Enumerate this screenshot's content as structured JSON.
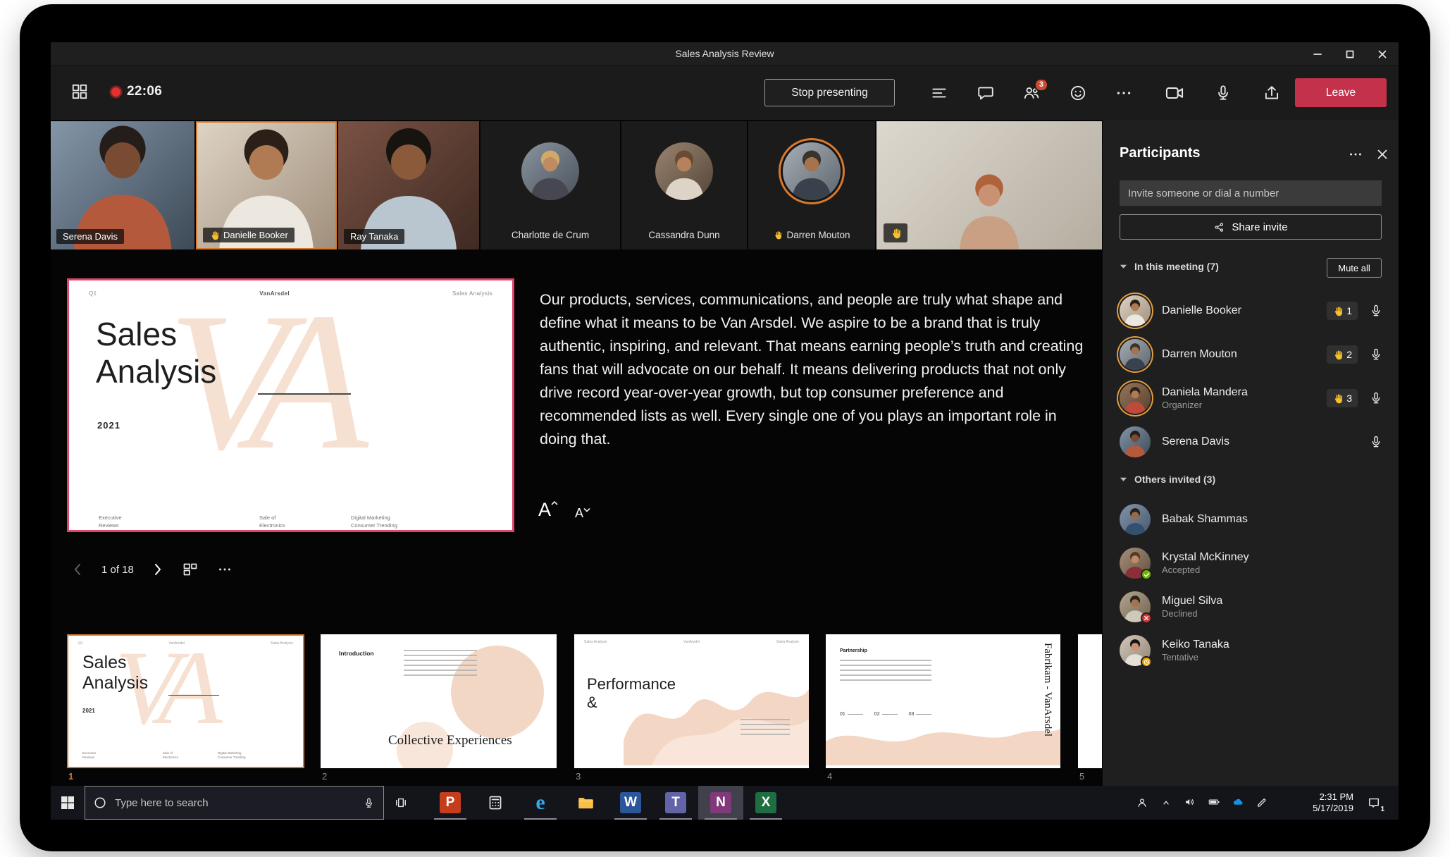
{
  "window": {
    "title": "Sales Analysis Review"
  },
  "toolbar": {
    "timer": "22:06",
    "stop_presenting": "Stop presenting",
    "people_badge": "3",
    "leave": "Leave"
  },
  "video_strip": {
    "tiles": [
      {
        "name": "Serena Davis"
      },
      {
        "name": "Danielle Booker"
      },
      {
        "name": "Ray Tanaka"
      },
      {
        "name": "Charlotte de Crum"
      },
      {
        "name": "Cassandra Dunn"
      },
      {
        "name": "Darren Mouton"
      },
      {
        "name": ""
      }
    ]
  },
  "slide": {
    "corner_label": "Q1",
    "brand": "VanArsdel",
    "header_right": "Sales Analysis",
    "watermark": "VA",
    "title_line1": "Sales",
    "title_line2": "Analysis",
    "year": "2021",
    "footer1a": "Executive",
    "footer1b": "Reviews",
    "footer2a": "Sale of",
    "footer2b": "Electronics",
    "footer3a": "Digital Marketing",
    "footer3b": "Consumer Trending"
  },
  "stage": {
    "body_text": "Our products, services, communications, and people are truly what shape and define what it means to be Van Arsdel. We aspire to be a brand that is truly authentic, inspiring, and relevant. That means earning people’s truth and creating fans that will advocate on our behalf. It means delivering products that not only drive record year-over-year growth, but top consumer preference and recommended lists as well. Every single one of you plays an important role in doing that.",
    "font_increase_label": "A",
    "font_decrease_label": "A",
    "nav_position": "1 of 18"
  },
  "thumbnails": {
    "t1_num": "1",
    "t2_num": "2",
    "t2_heading": "Introduction",
    "t2_title": "Collective Experiences",
    "t3_num": "3",
    "t3_header": "Sales Analysis",
    "t3_title_line1": "Performance",
    "t3_title_line2": "&",
    "t4_num": "4",
    "t4_heading": "Partnership",
    "t4_step1": "01",
    "t4_step2": "02",
    "t4_step3": "03",
    "t4_side_text": "Fabrikam - VanArsdel",
    "t5_num": "5"
  },
  "panel": {
    "title": "Participants",
    "invite_placeholder": "Invite someone or dial a number",
    "share_invite": "Share invite",
    "in_meeting_header": "In this meeting (7)",
    "mute_all": "Mute all",
    "in_meeting": [
      {
        "name": "Danielle Booker",
        "hand_order": "1"
      },
      {
        "name": "Darren Mouton",
        "hand_order": "2"
      },
      {
        "name": "Daniela Mandera",
        "role": "Organizer",
        "hand_order": "3"
      },
      {
        "name": "Serena Davis"
      }
    ],
    "others_header": "Others invited (3)",
    "others": [
      {
        "name": "Babak Shammas"
      },
      {
        "name": "Krystal McKinney",
        "status": "Accepted"
      },
      {
        "name": "Miguel Silva",
        "status": "Declined"
      },
      {
        "name": "Keiko Tanaka",
        "status": "Tentative"
      }
    ]
  },
  "taskbar": {
    "search_placeholder": "Type here to search",
    "apps": [
      {
        "icon": "powerpoint",
        "glyph": "P"
      },
      {
        "icon": "calculator",
        "glyph": ""
      },
      {
        "icon": "edge",
        "glyph": "e"
      },
      {
        "icon": "file-explorer",
        "glyph": ""
      },
      {
        "icon": "word",
        "glyph": "W"
      },
      {
        "icon": "teams",
        "glyph": "T"
      },
      {
        "icon": "onenote",
        "glyph": "N"
      },
      {
        "icon": "excel",
        "glyph": "X"
      }
    ],
    "time": "2:31 PM",
    "date": "5/17/2019",
    "notification_count": "1"
  },
  "colors": {
    "accent_orange": "#d87a2e",
    "presenting_border": "#e0456c",
    "leave_red": "#c4314b",
    "hand_yellow": "#f6c02c",
    "badge_red": "#cc4a31",
    "accepted_green": "#6bb700",
    "declined_red": "#d13438",
    "tentative_yellow": "#eaa300",
    "onedrive_blue": "#1490df"
  }
}
